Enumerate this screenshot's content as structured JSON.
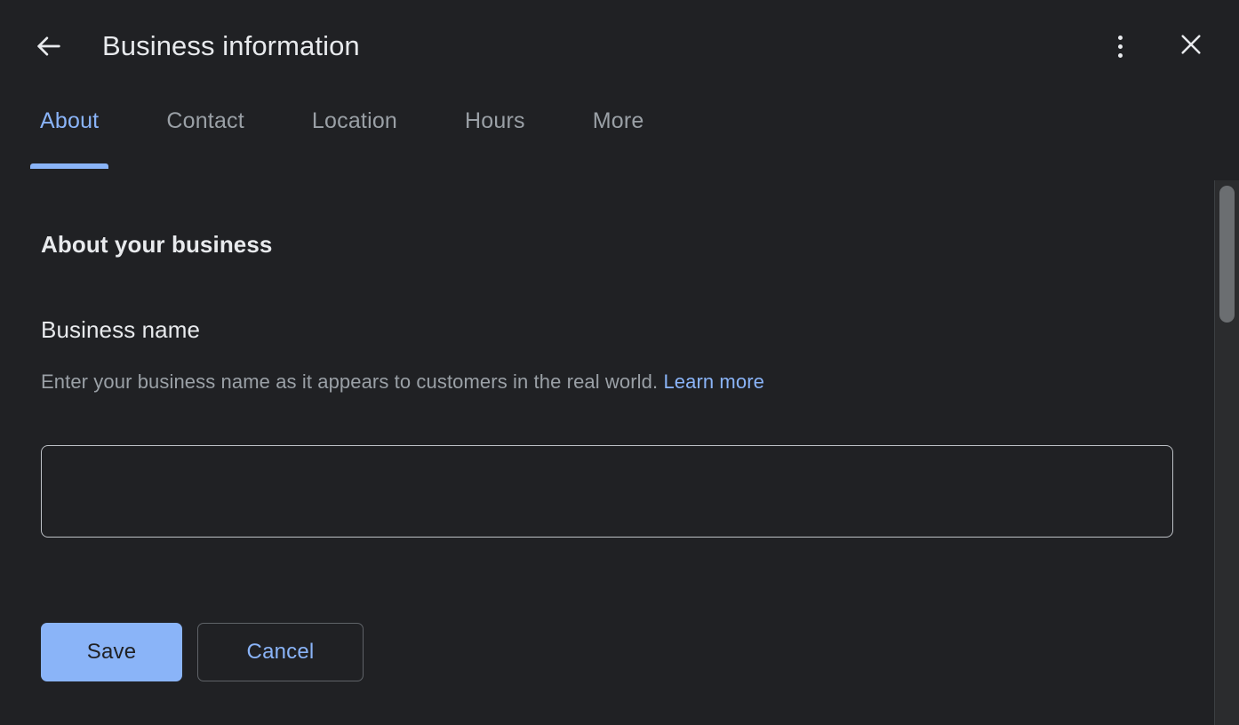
{
  "header": {
    "title": "Business information",
    "back_icon": "arrow-left-icon",
    "menu_icon": "more-vert-icon",
    "close_icon": "close-icon"
  },
  "tabs": [
    {
      "label": "About",
      "active": true
    },
    {
      "label": "Contact",
      "active": false
    },
    {
      "label": "Location",
      "active": false
    },
    {
      "label": "Hours",
      "active": false
    },
    {
      "label": "More",
      "active": false
    }
  ],
  "main": {
    "section_title": "About your business",
    "field": {
      "label": "Business name",
      "description": "Enter your business name as it appears to customers in the real world.",
      "learn_more": "Learn more",
      "value": "",
      "placeholder": ""
    },
    "buttons": {
      "save": "Save",
      "cancel": "Cancel"
    }
  },
  "colors": {
    "background": "#202124",
    "accent": "#8ab4f8",
    "text_primary": "#e8eaed",
    "text_secondary": "#9aa0a6",
    "input_border": "#bdc1c6",
    "outline_border": "#5f6368",
    "scroll_thumb": "#6b6e71"
  }
}
